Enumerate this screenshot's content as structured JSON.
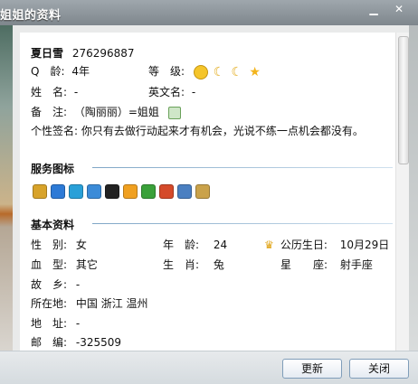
{
  "window": {
    "title": "姐姐的资料"
  },
  "header": {
    "nickname": "夏日雪",
    "qq_number": "276296887"
  },
  "basic_top": {
    "qage_label": "Q　龄:",
    "qage_value": "4年",
    "level_label": "等　级:",
    "name_label": "姓　名:",
    "name_value": "-",
    "english_name_label": "英文名:",
    "english_name_value": "-",
    "remark_label": "备　注:",
    "remark_value": "（陶丽丽）=姐姐",
    "signature_label": "个性签名:",
    "signature_value": "你只有去做行动起来才有机会，光说不练一点机会都没有。"
  },
  "service_icons": {
    "title": "服务图标",
    "icons": [
      {
        "name": "qq-show-icon",
        "color": "#d8a32a"
      },
      {
        "name": "qq-member-icon",
        "color": "#2d7ad6"
      },
      {
        "name": "qq-vip-p-icon",
        "color": "#29a0d8"
      },
      {
        "name": "phone-icon",
        "color": "#3b8bd8"
      },
      {
        "name": "penguin-icon",
        "color": "#222222"
      },
      {
        "name": "qzone-icon",
        "color": "#f0a020"
      },
      {
        "name": "game-icon",
        "color": "#3aa13a"
      },
      {
        "name": "home-icon",
        "color": "#d54a2a"
      },
      {
        "name": "camera-icon",
        "color": "#4a7fc1"
      },
      {
        "name": "pet-icon",
        "color": "#caa24a"
      }
    ]
  },
  "basic_info": {
    "title": "基本资料",
    "gender_label": "性　别:",
    "gender_value": "女",
    "age_label": "年　龄:",
    "age_value": "24",
    "birthday_label": "公历生日:",
    "birthday_value": "10月29日",
    "blood_label": "血　型:",
    "blood_value": "其它",
    "zodiac_label": "生　肖:",
    "zodiac_value": "兔",
    "constellation_label": "星　　座:",
    "constellation_value": "射手座",
    "hometown_label": "故　乡:",
    "hometown_value": "-",
    "location_label": "所在地:",
    "location_value": "中国 浙江 温州",
    "address_label": "地　址:",
    "address_value": "-",
    "postcode_label": "邮　编:",
    "postcode_value": "-325509"
  },
  "buttons": {
    "refresh": "更新",
    "close": "关闭"
  }
}
